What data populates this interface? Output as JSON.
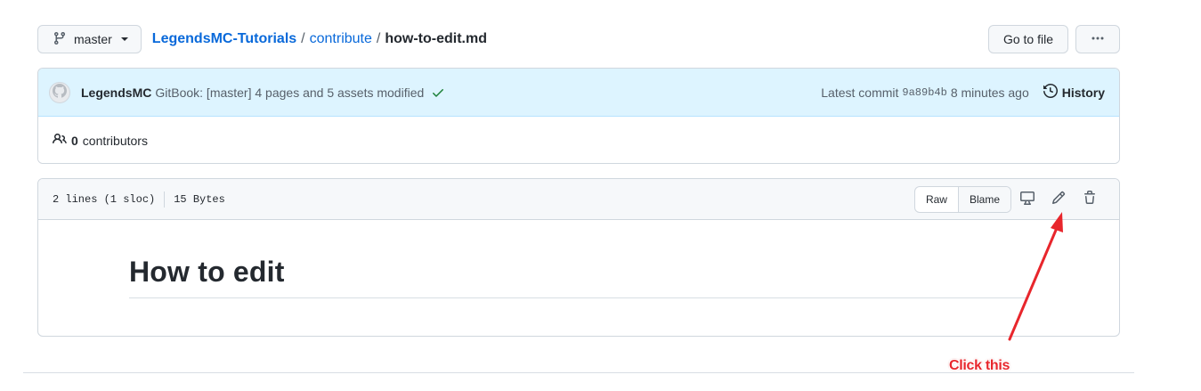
{
  "topbar": {
    "branch": "master",
    "repo": "LegendsMC-Tutorials",
    "separator": "/",
    "directory": "contribute",
    "file": "how-to-edit.md",
    "go_to_file": "Go to file",
    "more": "···"
  },
  "commit": {
    "author": "LegendsMC",
    "message": "GitBook: [master] 4 pages and 5 assets modified",
    "latest_label": "Latest commit",
    "sha": "9a89b4b",
    "time": "8 minutes ago",
    "history": "History"
  },
  "contributors": {
    "count": "0",
    "label": "contributors"
  },
  "file_header": {
    "lines": "2 lines (1 sloc)",
    "size": "15 Bytes",
    "raw": "Raw",
    "blame": "Blame"
  },
  "content": {
    "heading": "How to edit"
  },
  "annotation": {
    "text": "Click this",
    "color": "#e8262c"
  },
  "icons": [
    "git-branch-icon",
    "kebab-horizontal-icon",
    "github-avatar-icon",
    "check-icon",
    "history-icon",
    "people-icon",
    "desktop-icon",
    "pencil-icon",
    "trash-icon"
  ],
  "colors": {
    "link": "#0969da",
    "commit_bg": "#ddf4ff",
    "success": "#1a7f37",
    "border": "#d0d7de"
  }
}
